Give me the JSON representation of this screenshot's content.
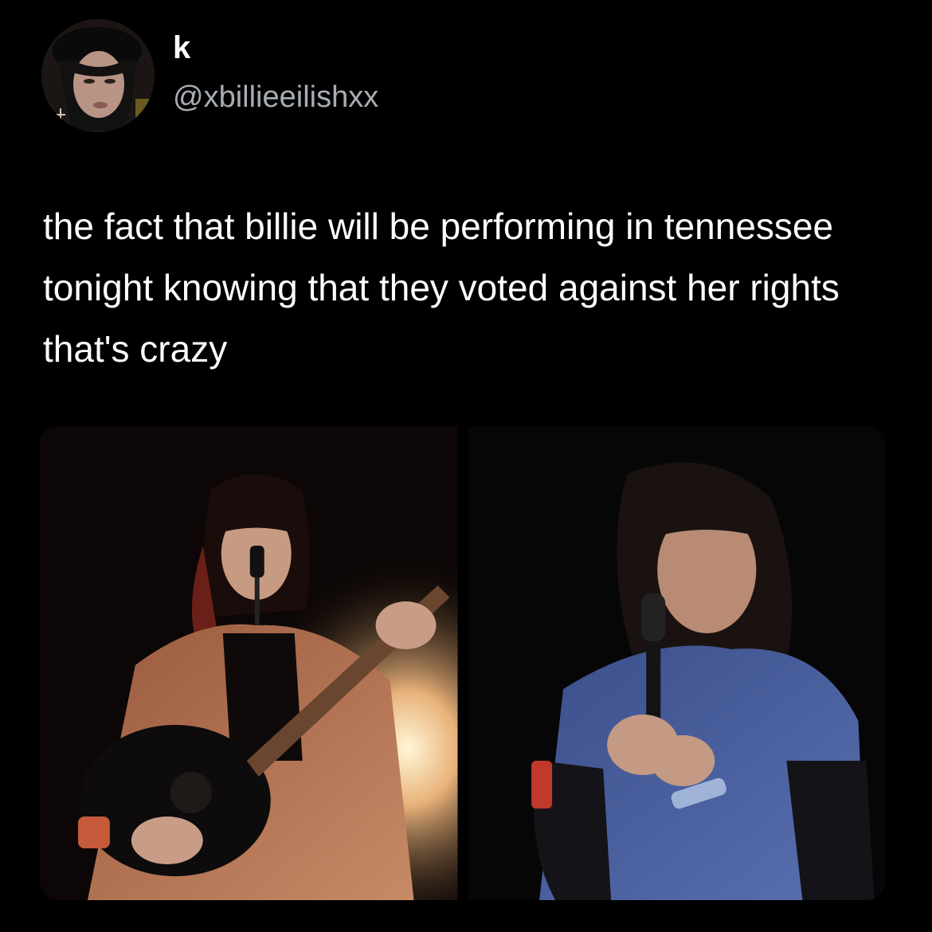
{
  "tweet": {
    "author": {
      "display_name": "k",
      "handle": "@xbillieeilishxx",
      "avatar_icon": "profile-avatar"
    },
    "text": "the fact that billie will be performing in tennessee tonight knowing that they voted against her rights that's crazy",
    "media": [
      {
        "icon": "concert-photo-guitar"
      },
      {
        "icon": "concert-photo-microphone"
      }
    ]
  },
  "colors": {
    "background": "#000000",
    "text_primary": "#ffffff",
    "text_secondary": "#a7adb2"
  }
}
